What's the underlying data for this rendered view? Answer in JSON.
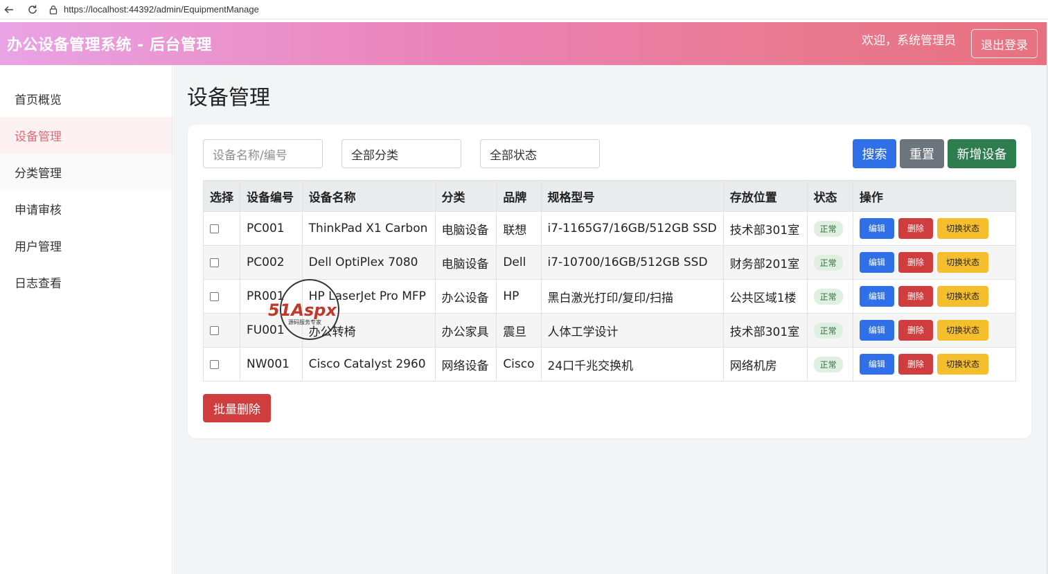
{
  "browser": {
    "url": "https://localhost:44392/admin/EquipmentManage"
  },
  "header": {
    "title": "办公设备管理系统 - 后台管理",
    "welcome": "欢迎，系统管理员",
    "logout_label": "退出登录"
  },
  "sidebar": {
    "items": [
      {
        "label": "首页概览"
      },
      {
        "label": "设备管理"
      },
      {
        "label": "分类管理"
      },
      {
        "label": "申请审核"
      },
      {
        "label": "用户管理"
      },
      {
        "label": "日志查看"
      }
    ]
  },
  "main": {
    "title": "设备管理",
    "filters": {
      "search_placeholder": "设备名称/编号",
      "category_value": "全部分类",
      "status_value": "全部状态"
    },
    "buttons": {
      "search": "搜索",
      "reset": "重置",
      "add": "新增设备",
      "bulk_delete": "批量删除"
    },
    "table": {
      "headers": [
        "选择",
        "设备编号",
        "设备名称",
        "分类",
        "品牌",
        "规格型号",
        "存放位置",
        "状态",
        "操作"
      ],
      "actions": {
        "edit": "编辑",
        "delete": "删除",
        "toggle": "切换状态"
      },
      "rows": [
        {
          "code": "PC001",
          "name": "ThinkPad X1 Carbon",
          "category": "电脑设备",
          "brand": "联想",
          "spec": "i7-1165G7/16GB/512GB SSD",
          "location": "技术部301室",
          "status": "正常"
        },
        {
          "code": "PC002",
          "name": "Dell OptiPlex 7080",
          "category": "电脑设备",
          "brand": "Dell",
          "spec": "i7-10700/16GB/512GB SSD",
          "location": "财务部201室",
          "status": "正常"
        },
        {
          "code": "PR001",
          "name": "HP LaserJet Pro MFP",
          "category": "办公设备",
          "brand": "HP",
          "spec": "黑白激光打印/复印/扫描",
          "location": "公共区域1楼",
          "status": "正常"
        },
        {
          "code": "FU001",
          "name": "办公转椅",
          "category": "办公家具",
          "brand": "震旦",
          "spec": "人体工学设计",
          "location": "技术部301室",
          "status": "正常"
        },
        {
          "code": "NW001",
          "name": "Cisco Catalyst 2960",
          "category": "网络设备",
          "brand": "Cisco",
          "spec": "24口千兆交换机",
          "location": "网络机房",
          "status": "正常"
        }
      ]
    }
  },
  "watermark": {
    "brand": "51Aspx",
    "tagline": "源码服务专家"
  },
  "colors": {
    "primary": "#2f6fe8",
    "danger": "#cf3d3f",
    "warning": "#f5be2c",
    "success": "#2e7d4f",
    "secondary": "#6c757d",
    "sidebar_active": "#e06a76"
  }
}
